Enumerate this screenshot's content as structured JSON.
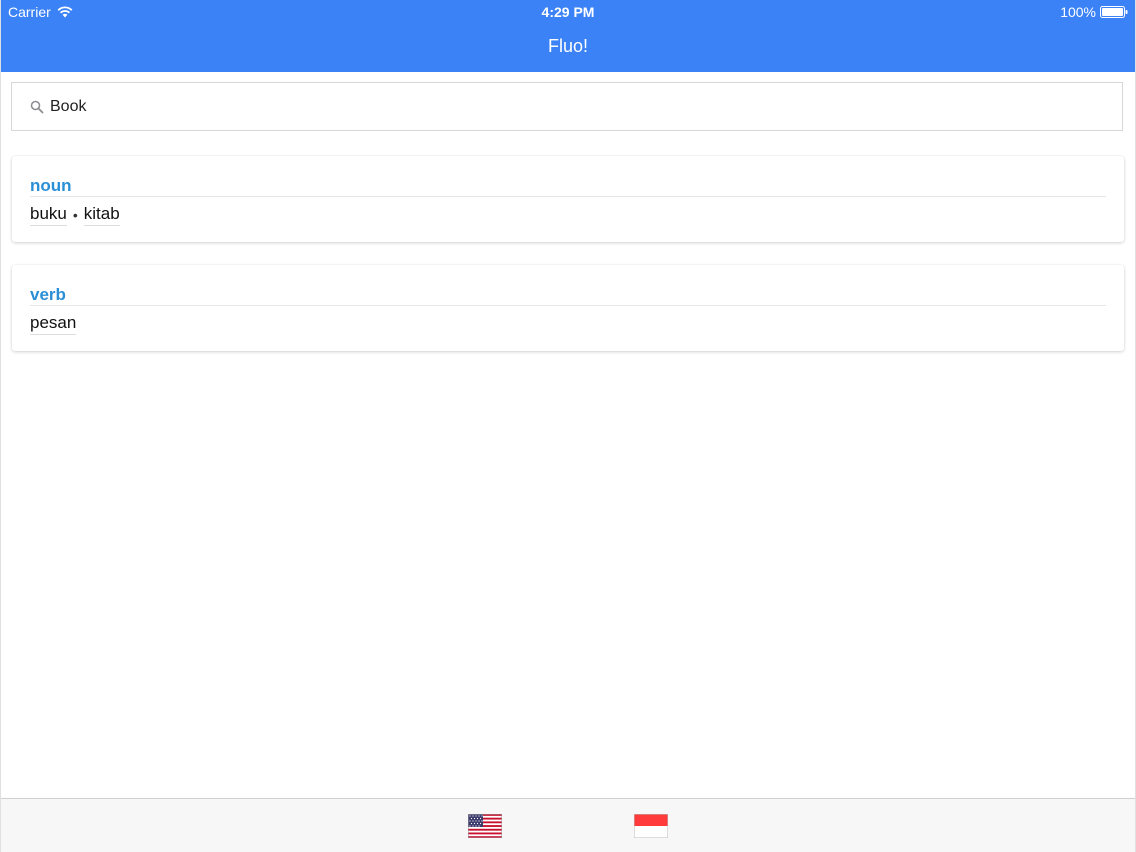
{
  "status_bar": {
    "carrier": "Carrier",
    "time": "4:29 PM",
    "battery": "100%",
    "wifi_icon": "wifi-icon",
    "battery_icon": "battery-icon"
  },
  "nav": {
    "title": "Fluo!"
  },
  "search": {
    "value": "Book",
    "icon": "search-icon"
  },
  "results": [
    {
      "part_of_speech": "noun",
      "translations": [
        "buku",
        "kitab"
      ]
    },
    {
      "part_of_speech": "verb",
      "translations": [
        "pesan"
      ]
    }
  ],
  "tabbar": {
    "tabs": [
      {
        "icon": "us-flag-icon",
        "language": "English"
      },
      {
        "icon": "indonesia-flag-icon",
        "language": "Indonesian"
      }
    ]
  },
  "colors": {
    "accent": "#3b82f6",
    "pos_label": "#2b8fd6"
  }
}
